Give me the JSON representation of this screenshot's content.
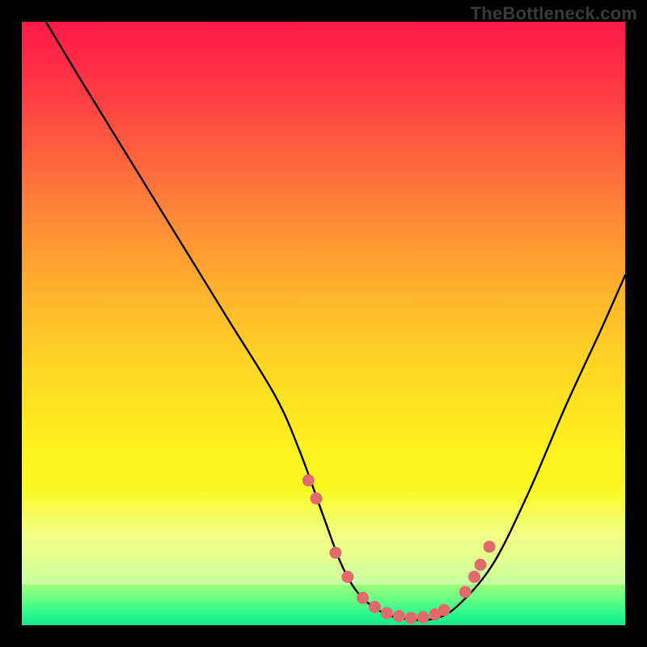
{
  "attribution": "TheBottleneck.com",
  "chart_data": {
    "type": "line",
    "title": "",
    "xlabel": "",
    "ylabel": "",
    "xlim": [
      0,
      100
    ],
    "ylim": [
      0,
      100
    ],
    "curve": {
      "x": [
        4,
        10,
        18,
        26,
        34,
        42,
        46,
        50,
        53,
        56,
        60,
        64,
        68,
        72,
        78,
        84,
        90,
        96,
        100
      ],
      "y": [
        100,
        90,
        77,
        64,
        51,
        38,
        29,
        18,
        10,
        5,
        2,
        1,
        1,
        3,
        10,
        22,
        36,
        49,
        58
      ]
    },
    "markers": {
      "x": [
        47.5,
        48.8,
        52.0,
        54.0,
        56.5,
        58.5,
        60.5,
        62.5,
        64.5,
        66.5,
        68.5,
        70.0,
        73.5,
        75.0,
        76.0,
        77.5
      ],
      "y": [
        24,
        21,
        12,
        8,
        4.5,
        3,
        2,
        1.5,
        1.2,
        1.3,
        1.8,
        2.5,
        5.5,
        8,
        10,
        13
      ]
    }
  },
  "colors": {
    "curve_stroke": "#000000",
    "marker_fill": "#e26a6a"
  }
}
